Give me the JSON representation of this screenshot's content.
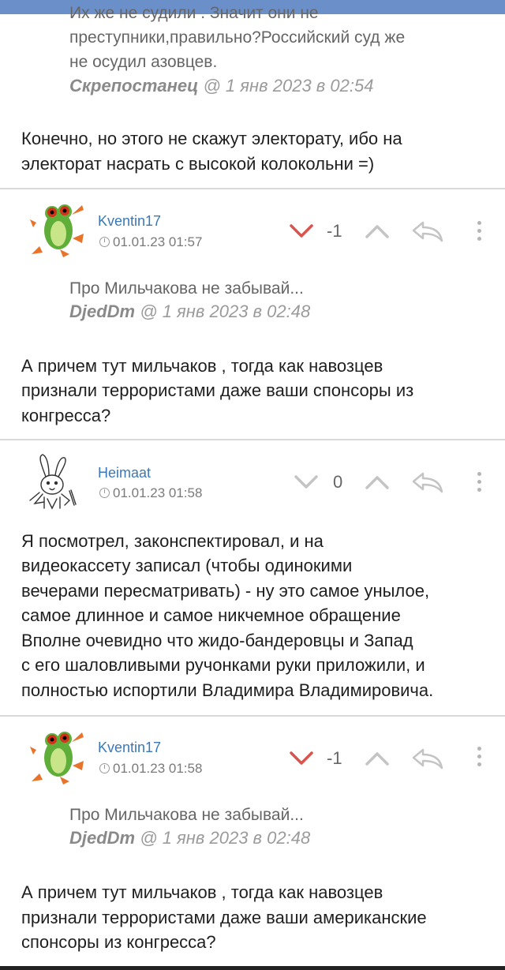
{
  "top_quote": {
    "lines": [
      "Их же не судили . Значит они не",
      "преступники,правильно?Российский суд же",
      "не осудил азовцев."
    ],
    "author": "Скрепостанец",
    "date": "@ 1 янв 2023 в 02:54"
  },
  "top_reply": {
    "lines": [
      "Конечно, но этого не скажут электорату, ибо на",
      "электорат насрать с высокой колокольни =)"
    ]
  },
  "comments": [
    {
      "username": "Kventin17",
      "date": "01.01.23 01:57",
      "score": "-1",
      "quote_text": "Про Мильчакова не забывай...",
      "quote_author": "DjedDm",
      "quote_date": "@ 1 янв 2023 в 02:48",
      "lines": [
        "А причем тут мильчаков , тогда как навозцев",
        "признали террористами даже ваши спонсоры из",
        "конгресса?"
      ]
    },
    {
      "username": "Heimaat",
      "date": "01.01.23 01:58",
      "score": "0",
      "lines": [
        "Я посмотрел, законспектировал, и на",
        "видеокассету записал (чтобы одинокими",
        "вечерами пересматривать) - ну это самое унылое,",
        "самое длинное и самое никчемное обращение",
        "Вполне очевидно что жидо-бандеровцы и Запад",
        "с его шаловливыми ручонками руки приложили, и",
        "полностью испортили Владимира Владимировича."
      ]
    },
    {
      "username": "Kventin17",
      "date": "01.01.23 01:58",
      "score": "-1",
      "quote_text": "Про Мильчакова не забывай...",
      "quote_author": "DjedDm",
      "quote_date": "@ 1 янв 2023 в 02:48",
      "lines": [
        "А причем тут мильчаков , тогда как навозцев",
        "признали террористами даже ваши американские",
        "спонсоры из конгресса?"
      ]
    }
  ]
}
